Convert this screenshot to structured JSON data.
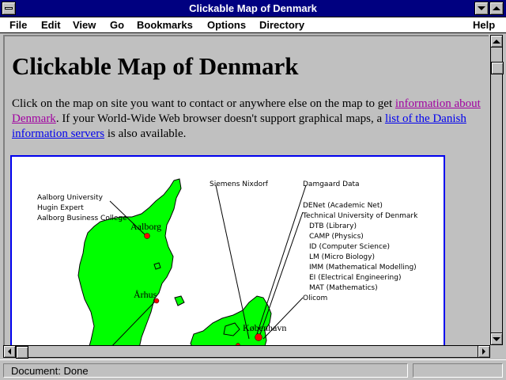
{
  "window": {
    "title": "Clickable Map of Denmark"
  },
  "menu": {
    "file": "File",
    "edit": "Edit",
    "view": "View",
    "go": "Go",
    "bookmarks": "Bookmarks",
    "options": "Options",
    "directory": "Directory",
    "help": "Help"
  },
  "page": {
    "heading": "Clickable Map of Denmark",
    "intro_1": "Click on the map on site you want to contact or anywhere else on the map to get ",
    "link_info": "information about Denmark",
    "intro_2": ". If your World-Wide Web browser doesn't support graphical maps, a ",
    "link_list": "list of the Danish information servers",
    "intro_3": " is also available."
  },
  "map": {
    "land_color": "#00ff00",
    "site_color": "#ff0000",
    "labels": {
      "aalborg_university": "Aalborg University",
      "hugin_expert": "Hugin Expert",
      "aalborg_business": "Aalborg Business College",
      "siemens": "Siemens Nixdorf",
      "damgaard": "Damgaard Data",
      "denet": "DENet (Academic Net)",
      "dtu": "Technical University of Denmark",
      "dtb": "DTB (Library)",
      "camp": "CAMP (Physics)",
      "id": "ID (Computer Science)",
      "lm": "LM (Micro Biology)",
      "imm": "IMM (Mathematical Modelling)",
      "ei": "EI (Electrical Engineering)",
      "mat": "MAT (Mathematics)",
      "olicom": "Olicom"
    },
    "cities": {
      "aalborg": "Aalborg",
      "aarhus": "Århus",
      "kobenhavn": "København"
    }
  },
  "status": {
    "text": "Document: Done"
  }
}
